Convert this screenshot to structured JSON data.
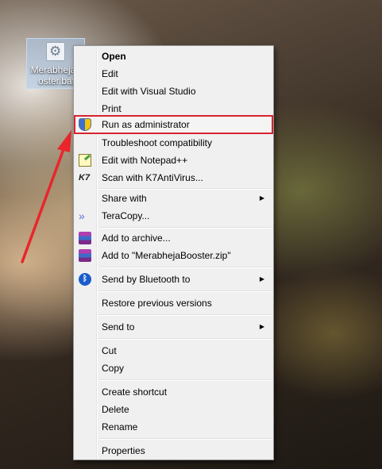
{
  "desktop": {
    "icon_label": "MerabhejaB\noster.bat"
  },
  "menu": {
    "items": [
      {
        "label": "Open"
      },
      {
        "label": "Edit"
      },
      {
        "label": "Edit with Visual Studio"
      },
      {
        "label": "Print"
      },
      {
        "label": "Run as administrator",
        "icon": "uac-shield-icon"
      },
      {
        "label": "Troubleshoot compatibility"
      },
      {
        "label": "Edit with Notepad++",
        "icon": "notepad-plus-plus-icon"
      },
      {
        "label": "Scan with K7AntiVirus...",
        "icon": "k7-antivirus-icon",
        "icon_text": "K7"
      },
      {
        "label": "Share with"
      },
      {
        "label": "TeraCopy...",
        "icon": "teracopy-icon"
      },
      {
        "label": "Add to archive...",
        "icon": "winrar-icon"
      },
      {
        "label": "Add to \"MerabhejaBooster.zip\"",
        "icon": "winrar-icon"
      },
      {
        "label": "Send by Bluetooth to",
        "icon": "bluetooth-icon"
      },
      {
        "label": "Restore previous versions"
      },
      {
        "label": "Send to"
      },
      {
        "label": "Cut"
      },
      {
        "label": "Copy"
      },
      {
        "label": "Create shortcut"
      },
      {
        "label": "Delete"
      },
      {
        "label": "Rename"
      },
      {
        "label": "Properties"
      }
    ]
  },
  "colors": {
    "highlight_border": "#d9232e",
    "arrow": "#e8262c"
  }
}
